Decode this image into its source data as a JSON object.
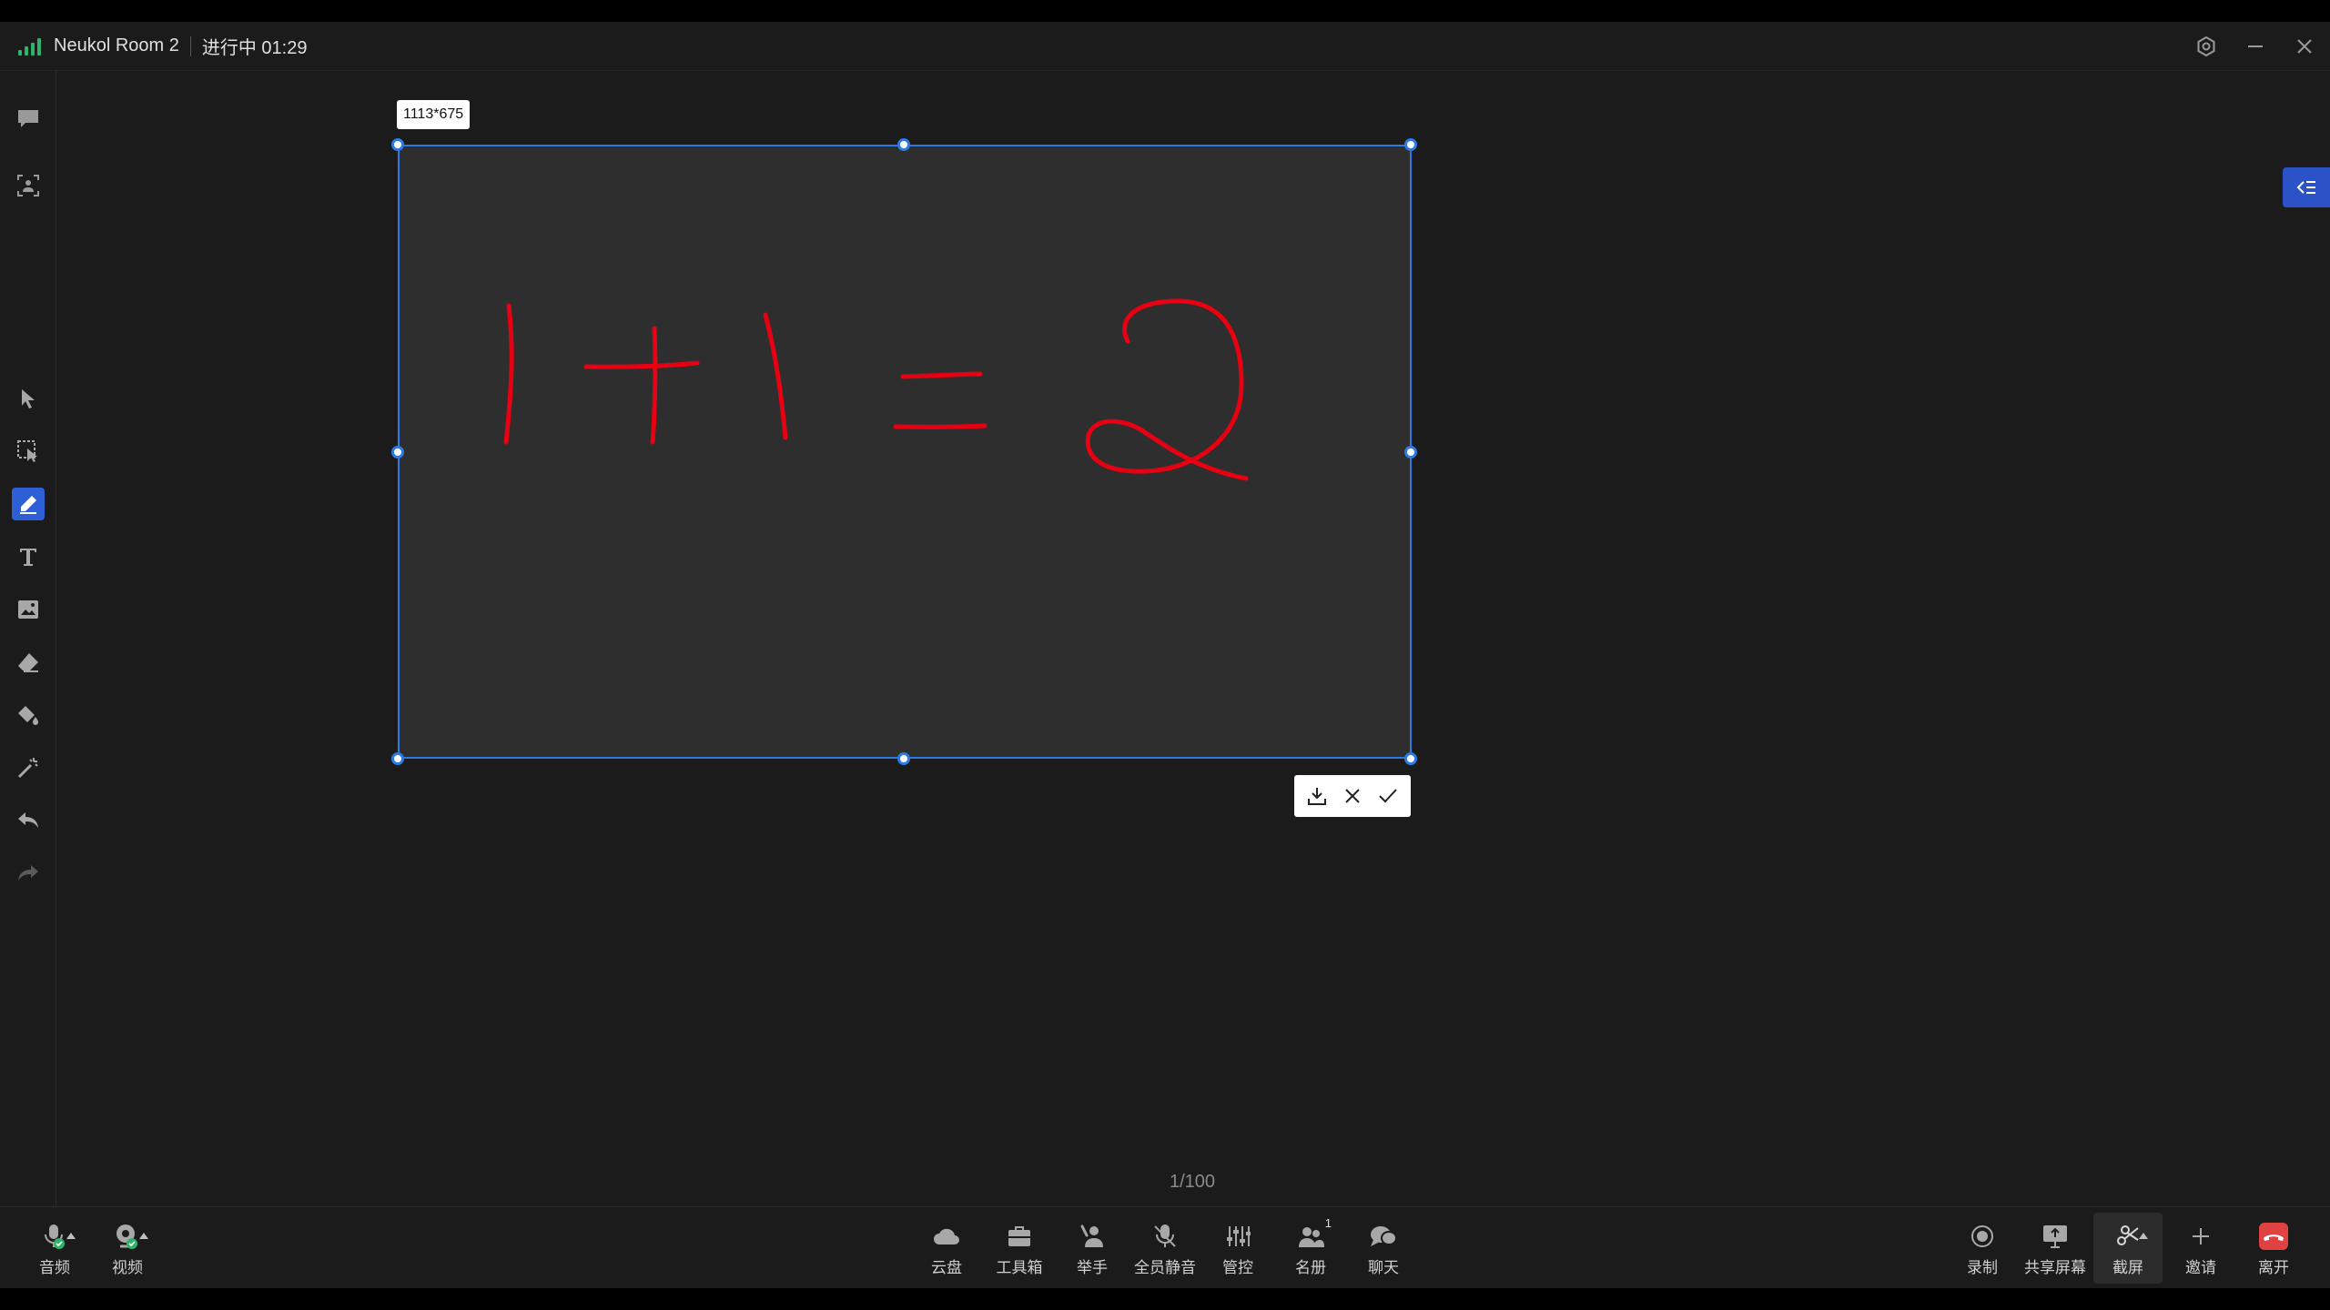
{
  "window": {
    "room_name": "Neukol Room 2",
    "status": "进行中 01:29"
  },
  "colors": {
    "accent": "#2c7be5",
    "active_tool": "#2f5fd6",
    "ink": "#e60012",
    "signal": "#2fb36a",
    "leave": "#e04141"
  },
  "sidebar": {
    "tools": [
      {
        "name": "chat-bubble-icon"
      },
      {
        "name": "screen-capture-icon"
      },
      {
        "name": "pointer-icon"
      },
      {
        "name": "select-area-icon"
      },
      {
        "name": "pen-icon",
        "active": true
      },
      {
        "name": "text-icon"
      },
      {
        "name": "image-icon"
      },
      {
        "name": "eraser-icon"
      },
      {
        "name": "paint-bucket-icon"
      },
      {
        "name": "laser-pointer-icon"
      },
      {
        "name": "undo-icon"
      },
      {
        "name": "redo-icon"
      }
    ]
  },
  "selection": {
    "dimension_label": "1113*675"
  },
  "crop_toolbar": {
    "actions": [
      "download-icon",
      "close-icon",
      "check-icon"
    ]
  },
  "page": {
    "indicator": "1/100"
  },
  "bottom_bar": {
    "left": [
      {
        "label": "音频",
        "icon": "microphone-icon"
      },
      {
        "label": "视频",
        "icon": "camera-icon"
      }
    ],
    "center": [
      {
        "label": "云盘",
        "icon": "cloud-icon"
      },
      {
        "label": "工具箱",
        "icon": "toolbox-icon"
      },
      {
        "label": "举手",
        "icon": "raise-hand-icon"
      },
      {
        "label": "全员静音",
        "icon": "mute-all-icon"
      },
      {
        "label": "管控",
        "icon": "controls-icon"
      },
      {
        "label": "名册",
        "icon": "roster-icon",
        "badge": "1"
      },
      {
        "label": "聊天",
        "icon": "chat-icon"
      }
    ],
    "right": [
      {
        "label": "录制",
        "icon": "record-icon"
      },
      {
        "label": "共享屏幕",
        "icon": "share-screen-icon"
      },
      {
        "label": "截屏",
        "icon": "scissors-icon",
        "active": true
      },
      {
        "label": "邀请",
        "icon": "plus-icon"
      },
      {
        "label": "离开",
        "icon": "hang-up-icon"
      }
    ]
  }
}
